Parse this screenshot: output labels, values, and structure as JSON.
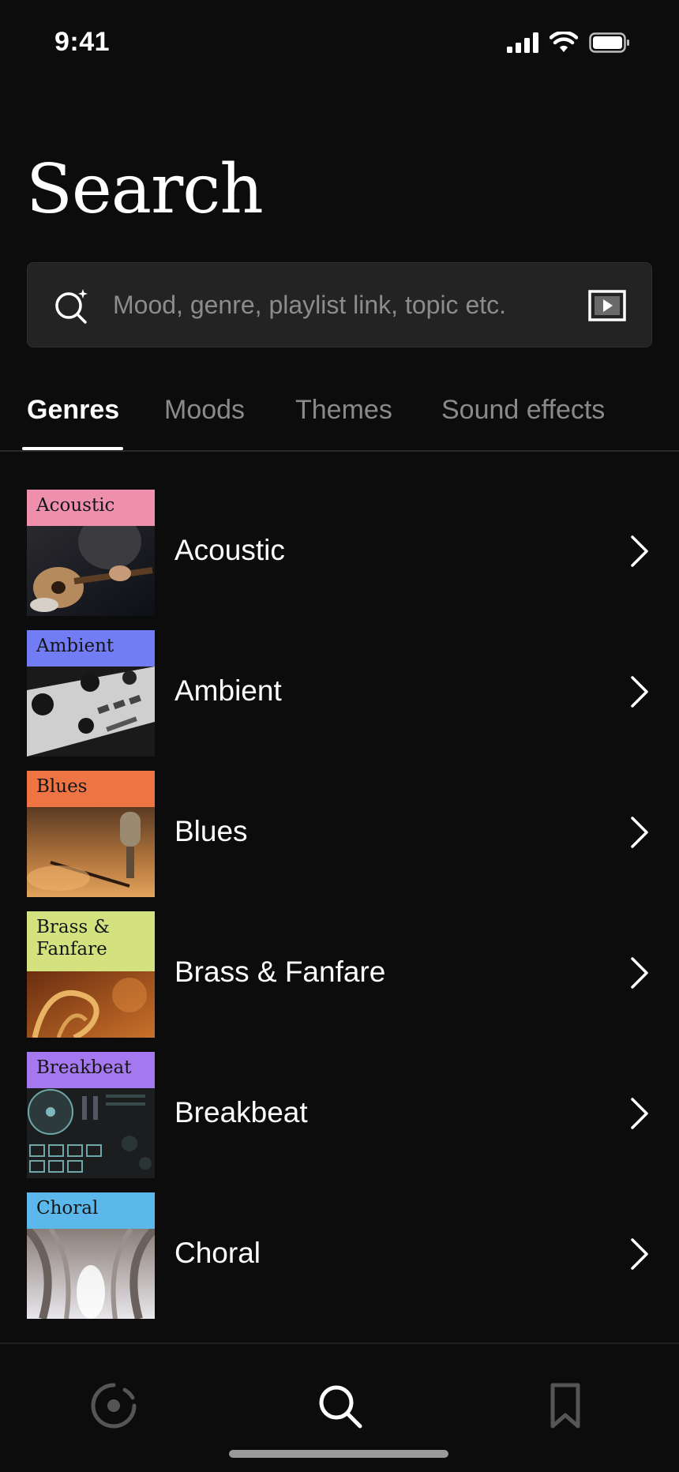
{
  "status_bar": {
    "time": "9:41"
  },
  "header": {
    "title": "Search"
  },
  "search": {
    "placeholder": "Mood, genre, playlist link, topic etc."
  },
  "tabs": [
    {
      "label": "Genres",
      "active": true
    },
    {
      "label": "Moods",
      "active": false
    },
    {
      "label": "Themes",
      "active": false
    },
    {
      "label": "Sound effects",
      "active": false
    }
  ],
  "genres": [
    {
      "thumb_label": "Acoustic",
      "name": "Acoustic",
      "label_color": "#ee8fae"
    },
    {
      "thumb_label": "Ambient",
      "name": "Ambient",
      "label_color": "#727cf5"
    },
    {
      "thumb_label": "Blues",
      "name": "Blues",
      "label_color": "#ee7443"
    },
    {
      "thumb_label": "Brass & Fanfare",
      "name": "Brass & Fanfare",
      "label_color": "#d3e27f"
    },
    {
      "thumb_label": "Breakbeat",
      "name": "Breakbeat",
      "label_color": "#a678f0"
    },
    {
      "thumb_label": "Choral",
      "name": "Choral",
      "label_color": "#5cb7ea"
    }
  ],
  "bottom_nav": [
    {
      "icon": "radio-icon",
      "active": false
    },
    {
      "icon": "search-icon",
      "active": true
    },
    {
      "icon": "bookmark-icon",
      "active": false
    }
  ],
  "colors": {
    "background": "#0c0c0c",
    "search_bar": "#232323",
    "inactive_tab": "#8a8a8a"
  }
}
